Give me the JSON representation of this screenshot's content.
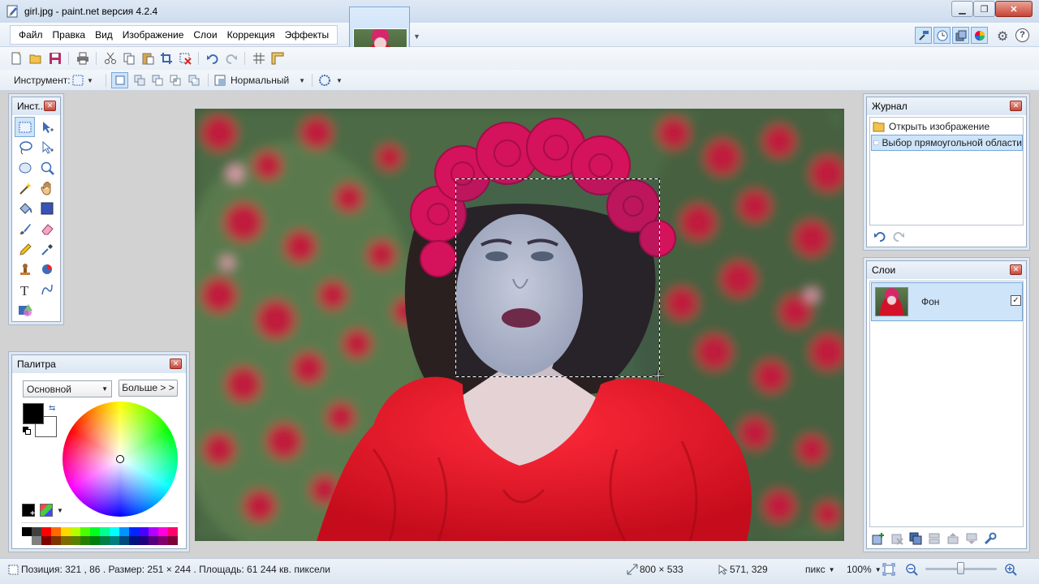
{
  "window": {
    "title": "girl.jpg - paint.net версия 4.2.4"
  },
  "menu": [
    "Файл",
    "Правка",
    "Вид",
    "Изображение",
    "Слои",
    "Коррекция",
    "Эффекты"
  ],
  "toolbar2": {
    "tool_label": "Инструмент:",
    "blend_mode": "Нормальный"
  },
  "tools": {
    "title": "Инст...",
    "icons": [
      "rectangle-select-icon",
      "move-selected-icon",
      "lasso-select-icon",
      "move-selection-icon",
      "ellipse-select-icon",
      "zoom-icon",
      "magic-wand-icon",
      "pan-icon",
      "paint-bucket-icon",
      "gradient-icon",
      "paintbrush-icon",
      "eraser-icon",
      "pencil-icon",
      "color-picker-icon",
      "clone-stamp-icon",
      "recolor-icon",
      "text-icon",
      "line-curve-icon",
      "shapes-icon"
    ]
  },
  "palette": {
    "title": "Палитра",
    "mode": "Основной",
    "more_button": "Больше > >",
    "primary_color": "#000000",
    "secondary_color": "#ffffff",
    "swatches": [
      "#000000",
      "#404040",
      "#ff0000",
      "#ff6a00",
      "#ffd800",
      "#b6ff00",
      "#4cff00",
      "#00ff21",
      "#00ff90",
      "#00ffff",
      "#0094ff",
      "#0026ff",
      "#4800ff",
      "#b200ff",
      "#ff00dc",
      "#ff006e",
      "#ffffff",
      "#808080",
      "#7f0000",
      "#7f3300",
      "#7f6a00",
      "#5b7f00",
      "#267f00",
      "#007f0e",
      "#007f46",
      "#007f7f",
      "#004a7f",
      "#00137f",
      "#21007f",
      "#57007f",
      "#7f006e",
      "#7f0037"
    ]
  },
  "history": {
    "title": "Журнал",
    "items": [
      {
        "label": "Открыть изображение",
        "icon": "folder-icon"
      },
      {
        "label": "Выбор прямоугольной области",
        "icon": "rectangle-select-icon"
      }
    ]
  },
  "layers": {
    "title": "Слои",
    "items": [
      {
        "name": "Фон",
        "visible": true
      }
    ]
  },
  "status": {
    "position": "Позиция: 321 , 86 . Размер: 251 × 244 . Площадь: 61 244 кв. пиксели",
    "image_size": "800 × 533",
    "cursor": "571, 329",
    "units": "пикс",
    "zoom": "100%"
  },
  "colors": {
    "accent": "#7aa7d8",
    "selection_highlight": "#cde4f9"
  }
}
